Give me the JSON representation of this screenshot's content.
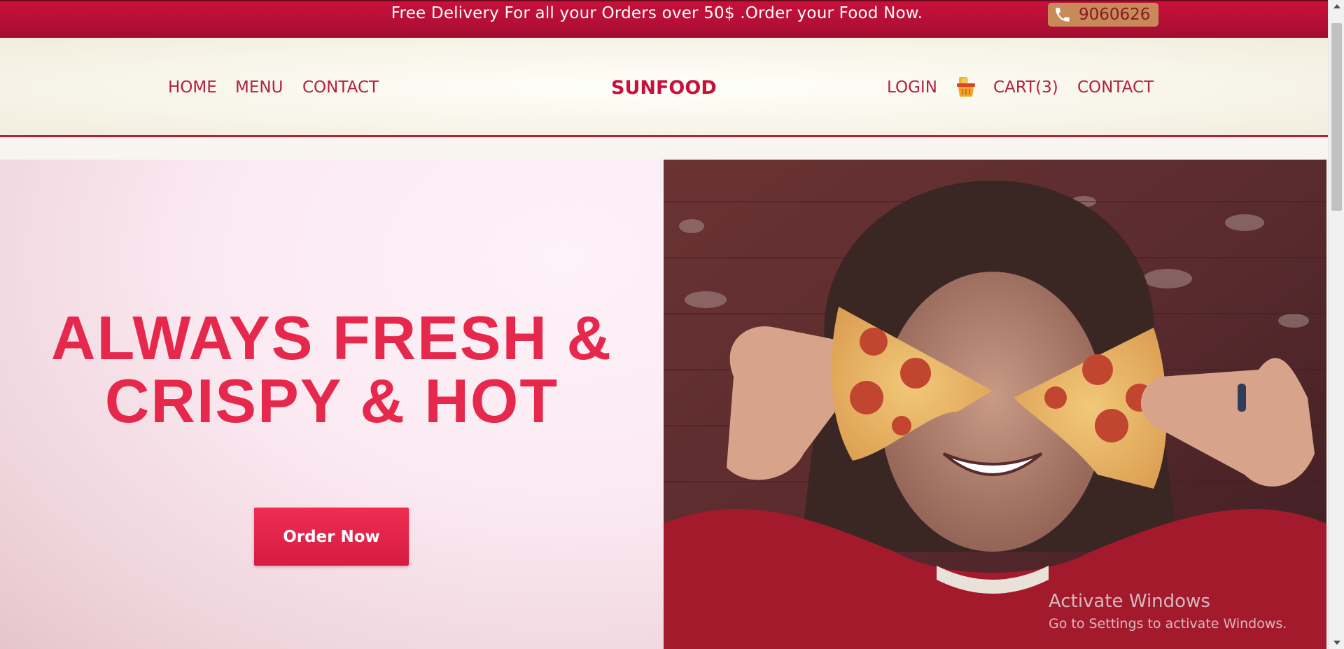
{
  "promo": {
    "text": "Free Delivery For all your Orders over 50$ .Order your Food Now.",
    "phone": "9060626"
  },
  "nav": {
    "left": [
      {
        "label": "HOME"
      },
      {
        "label": "MENU"
      },
      {
        "label": "CONTACT"
      }
    ],
    "brand": "SUNFOOD",
    "right": [
      {
        "label": "LOGIN"
      },
      {
        "label": "CART(3)"
      },
      {
        "label": "CONTACT"
      }
    ]
  },
  "hero": {
    "title_line1": "ALWAYS FRESH &",
    "title_line2": "CRISPY & HOT",
    "cta": "Order Now"
  },
  "watermark": {
    "title": "Activate Windows",
    "subtitle": "Go to Settings to activate Windows."
  },
  "icons": {
    "phone": "phone-icon",
    "basket": "basket-icon",
    "scroll_up": "chevron-up-icon",
    "scroll_down": "chevron-down-icon"
  },
  "colors": {
    "brand_red": "#c8103a",
    "accent_red": "#e5284c",
    "nav_text": "#b4213c",
    "phone_pill": "#c98a5a"
  }
}
